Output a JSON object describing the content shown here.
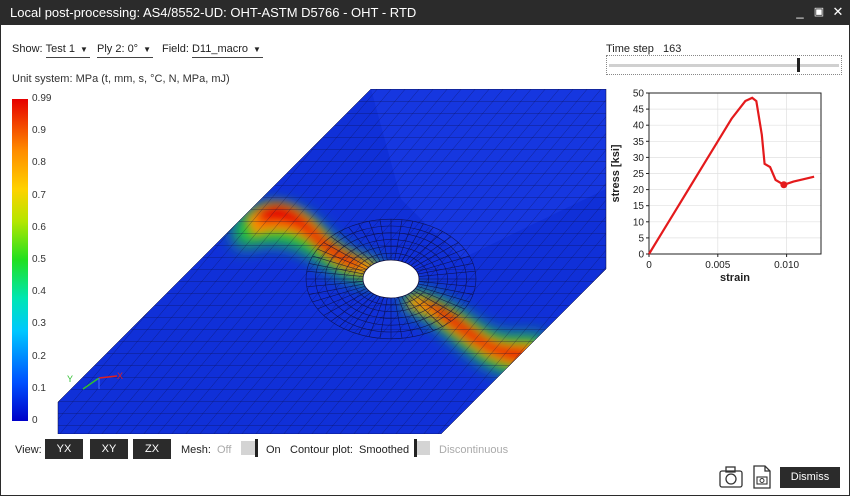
{
  "window": {
    "title": "Local post-processing: AS4/8552-UD: OHT-ASTM D5766 - OHT - RTD",
    "minimize_glyph": "_",
    "maximize_glyph": "▣",
    "close_glyph": "✕"
  },
  "controls": {
    "show_label": "Show:",
    "show_value": "Test 1",
    "ply_value": "Ply 2: 0°",
    "field_label": "Field:",
    "field_value": "D11_macro",
    "unit_system": "Unit system: MPa (t, mm, s, °C, N, MPa, mJ)",
    "time_step_label": "Time step",
    "time_step_value": "163",
    "time_step_fraction": 0.82
  },
  "colorbar": {
    "ticks": [
      "0.99",
      "0.9",
      "0.8",
      "0.7",
      "0.6",
      "0.5",
      "0.4",
      "0.3",
      "0.2",
      "0.1",
      "0"
    ],
    "colors": [
      "#0000c8",
      "#0050ff",
      "#00c8ff",
      "#20e020",
      "#ffd200",
      "#e60000"
    ]
  },
  "triad": {
    "y_label": "Y",
    "x_label": "X"
  },
  "chart_data": {
    "type": "line",
    "xlabel": "strain",
    "ylabel": "stress [ksi]",
    "xlim": [
      0,
      0.0125
    ],
    "ylim": [
      0,
      50
    ],
    "x_ticks": [
      "0",
      "0.005",
      "0.010"
    ],
    "y_ticks": [
      "0",
      "5",
      "10",
      "15",
      "20",
      "25",
      "30",
      "35",
      "40",
      "45",
      "50"
    ],
    "grid": true,
    "series": [
      {
        "color": "#e41a1c",
        "x": [
          0,
          0.001,
          0.002,
          0.003,
          0.004,
          0.005,
          0.006,
          0.007,
          0.0075,
          0.0078,
          0.0082,
          0.0084,
          0.0088,
          0.0092,
          0.0098,
          0.0105,
          0.0112,
          0.012
        ],
        "y": [
          0,
          7,
          14,
          21,
          28,
          35,
          42,
          47.5,
          48.5,
          47.5,
          37,
          28,
          27,
          23,
          21.5,
          22.5,
          23.2,
          24
        ]
      }
    ],
    "marker": {
      "x": 0.0098,
      "y": 21.5
    }
  },
  "bottom": {
    "view_label": "View:",
    "views": [
      "YX",
      "XY",
      "ZX"
    ],
    "mesh_label": "Mesh:",
    "mesh_off": "Off",
    "mesh_on": "On",
    "contour_label": "Contour plot:",
    "smoothed": "Smoothed",
    "discontinuous": "Discontinuous",
    "dismiss": "Dismiss",
    "camera_icon": "camera-icon",
    "export_image_icon": "export-image-icon"
  }
}
